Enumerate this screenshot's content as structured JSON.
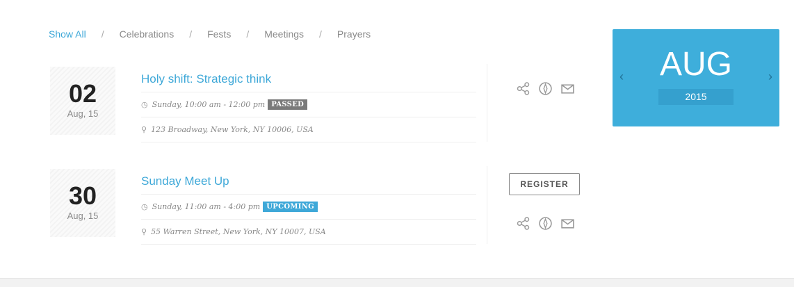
{
  "filters": {
    "items": [
      {
        "label": "Show All",
        "active": true
      },
      {
        "label": "Celebrations"
      },
      {
        "label": "Fests"
      },
      {
        "label": "Meetings"
      },
      {
        "label": "Prayers"
      }
    ],
    "separator": "/"
  },
  "events": [
    {
      "day": "02",
      "month": "Aug, 15",
      "title": "Holy shift: Strategic think",
      "time": "Sunday, 10:00 am - 12:00 pm",
      "status": "PASSED",
      "address": "123 Broadway, New York, NY 10006, USA"
    },
    {
      "day": "30",
      "month": "Aug, 15",
      "title": "Sunday Meet Up",
      "time": "Sunday, 11:00 am - 4:00 pm",
      "status": "UPCOMING",
      "address": "55 Warren Street, New York, NY 10007, USA",
      "register_label": "REGISTER"
    }
  ],
  "social_icons": [
    "share-icon",
    "compass-icon",
    "mail-icon"
  ],
  "calendar": {
    "month": "AUG",
    "year": "2015",
    "prev": "‹",
    "next": "›"
  },
  "icons": {
    "clock": "◷",
    "pin": "⚲"
  },
  "colors": {
    "accent": "#3ea8d8",
    "calendar_bg": "#3eaedb",
    "passed_badge": "#7a7a7a",
    "upcoming_badge": "#3ea8d8"
  }
}
